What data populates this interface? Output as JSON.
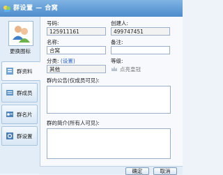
{
  "window": {
    "title": "群设置 — 合窝"
  },
  "sidebar": {
    "change_avatar_label": "更换图标",
    "items": [
      {
        "label": "群资料",
        "icon": "profile-icon",
        "active": true
      },
      {
        "label": "群成员",
        "icon": "members-icon",
        "active": false
      },
      {
        "label": "群名片",
        "icon": "card-icon",
        "active": false
      },
      {
        "label": "群设置",
        "icon": "settings-icon",
        "active": false
      }
    ]
  },
  "form": {
    "group_number": {
      "label": "号码:",
      "value": "125911161"
    },
    "creator": {
      "label": "创建人:",
      "value": "499747451"
    },
    "name": {
      "label": "名称:",
      "value": "合窝"
    },
    "remark": {
      "label": "备注:",
      "value": ""
    },
    "category": {
      "label": "分类:",
      "link": "(设置)",
      "value": "其他"
    },
    "level": {
      "label": "等级:",
      "value": "点亮皇冠"
    },
    "announcement": {
      "label": "群内公告(仅成员可见):",
      "value": ""
    },
    "intro": {
      "label": "群的简介(所有人可见):",
      "value": ""
    }
  },
  "buttons": {
    "ok": "确定",
    "cancel": "取消"
  },
  "colors": {
    "titlebar": "#4d8bcb",
    "link": "#2a64c5",
    "sidebar": "#e2edf8"
  }
}
